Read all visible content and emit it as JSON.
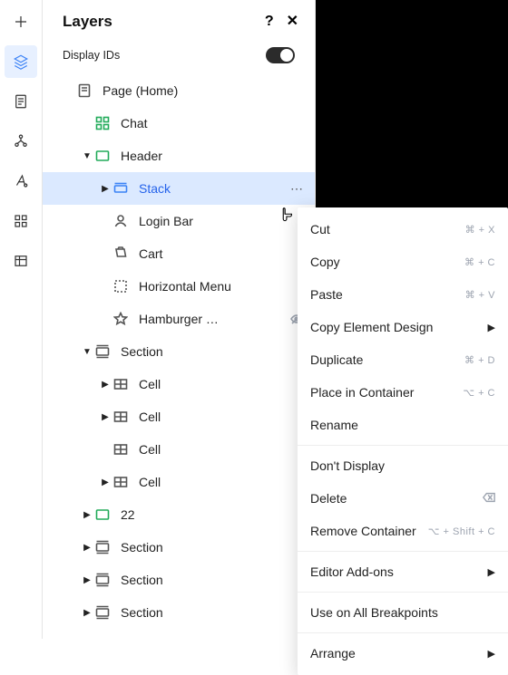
{
  "panel": {
    "title": "Layers",
    "display_ids_label": "Display IDs"
  },
  "tree": {
    "page": "Page (Home)",
    "chat": "Chat",
    "header": "Header",
    "stack": "Stack",
    "login_bar": "Login Bar",
    "cart": "Cart",
    "horizontal_menu": "Horizontal Menu",
    "hamburger": "Hamburger …",
    "section1": "Section",
    "cell1": "Cell",
    "cell2": "Cell",
    "cell3": "Cell",
    "cell4": "Cell",
    "twentytwo": "22",
    "section2": "Section",
    "section3": "Section",
    "section4": "Section"
  },
  "menu": {
    "cut": {
      "label": "Cut",
      "shortcut": "⌘ + X"
    },
    "copy": {
      "label": "Copy",
      "shortcut": "⌘ + C"
    },
    "paste": {
      "label": "Paste",
      "shortcut": "⌘ + V"
    },
    "copy_design": {
      "label": "Copy Element Design"
    },
    "duplicate": {
      "label": "Duplicate",
      "shortcut": "⌘ + D"
    },
    "place_container": {
      "label": "Place in Container",
      "shortcut": "⌥ + C"
    },
    "rename": {
      "label": "Rename"
    },
    "dont_display": {
      "label": "Don't Display"
    },
    "delete": {
      "label": "Delete"
    },
    "remove_container": {
      "label": "Remove Container",
      "shortcut": "⌥ + Shift + C"
    },
    "editor_addons": {
      "label": "Editor Add-ons"
    },
    "use_all_breakpoints": {
      "label": "Use on All Breakpoints"
    },
    "arrange": {
      "label": "Arrange"
    }
  }
}
